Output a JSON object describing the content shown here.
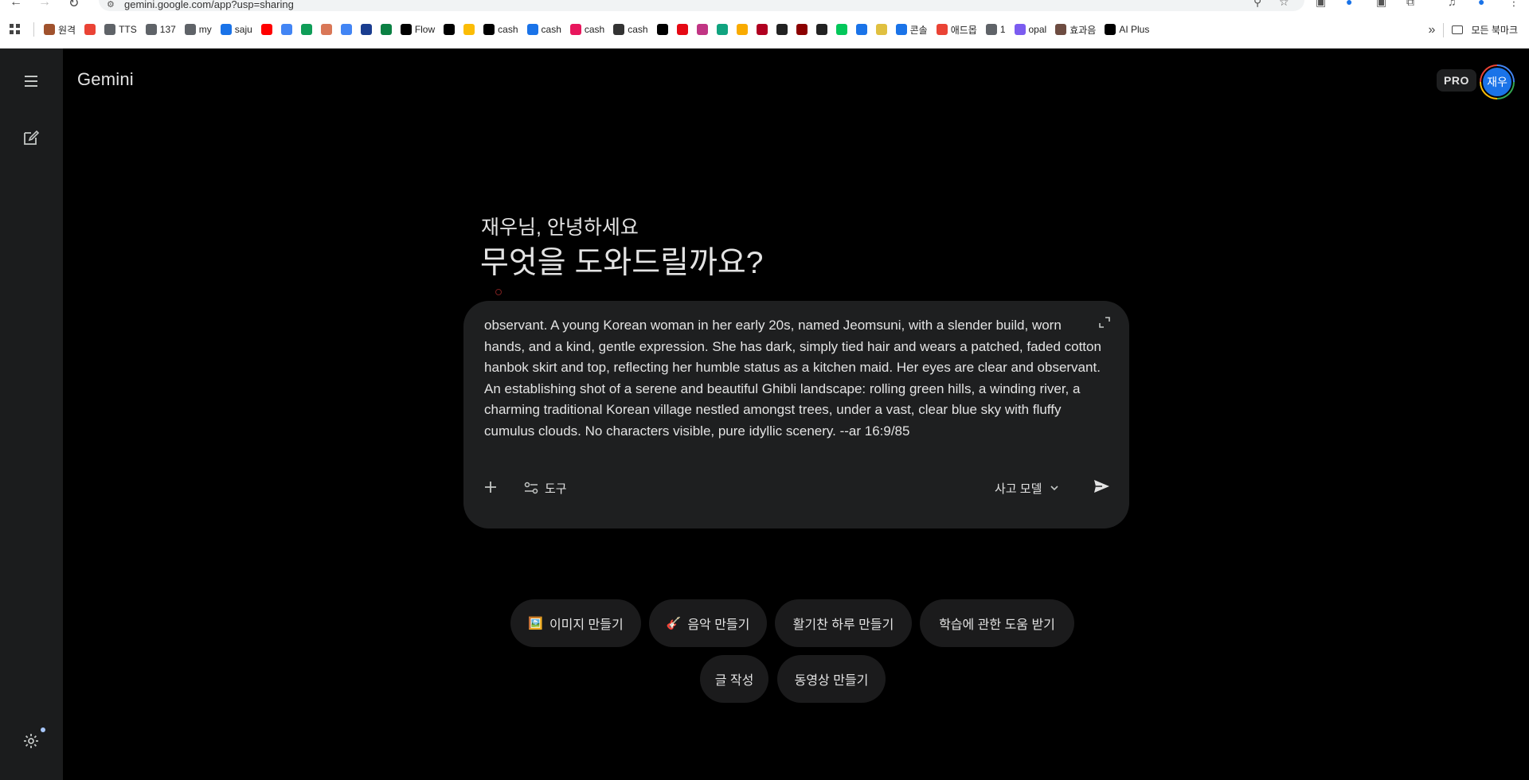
{
  "browser": {
    "url": "gemini.google.com/app?usp=sharing",
    "bookmarks": [
      {
        "label": "원격",
        "icon": "bookmark-folder-icon",
        "color": "#a0522d"
      },
      {
        "label": "",
        "icon": "gmail-icon",
        "color": "#ea4335"
      },
      {
        "label": "TTS",
        "icon": "globe-icon",
        "color": "#5f6368"
      },
      {
        "label": "137",
        "icon": "globe-icon",
        "color": "#5f6368"
      },
      {
        "label": "my",
        "icon": "globe-icon",
        "color": "#5f6368"
      },
      {
        "label": "saju",
        "icon": "saju-icon",
        "color": "#1a73e8"
      },
      {
        "label": "",
        "icon": "youtube-icon",
        "color": "#ff0000"
      },
      {
        "label": "",
        "icon": "docs-icon",
        "color": "#4285f4"
      },
      {
        "label": "",
        "icon": "sheets-icon",
        "color": "#0f9d58"
      },
      {
        "label": "",
        "icon": "claude-icon",
        "color": "#d97757"
      },
      {
        "label": "",
        "icon": "gemini-star-icon",
        "color": "#4285f4"
      },
      {
        "label": "",
        "icon": "p-icon",
        "color": "#1a3d8f"
      },
      {
        "label": "",
        "icon": "chart-icon",
        "color": "#0b8043"
      },
      {
        "label": "Flow",
        "icon": "flow-icon",
        "color": "#000000"
      },
      {
        "label": "",
        "icon": "openai-icon",
        "color": "#000000"
      },
      {
        "label": "",
        "icon": "drive-icon",
        "color": "#fbbc05"
      },
      {
        "label": "cash",
        "icon": "cash-icon",
        "color": "#000000"
      },
      {
        "label": "cash",
        "icon": "cash-icon",
        "color": "#1a73e8"
      },
      {
        "label": "cash",
        "icon": "cash-icon",
        "color": "#e8175d"
      },
      {
        "label": "cash",
        "icon": "cash-icon",
        "color": "#333333"
      },
      {
        "label": "",
        "icon": "triangle-icon",
        "color": "#000000"
      },
      {
        "label": "",
        "icon": "netflix-icon",
        "color": "#e50914"
      },
      {
        "label": "",
        "icon": "instagram-icon",
        "color": "#c13584"
      },
      {
        "label": "",
        "icon": "chatgpt-icon",
        "color": "#10a37f"
      },
      {
        "label": "",
        "icon": "cart-icon",
        "color": "#f9ab00"
      },
      {
        "label": "",
        "icon": "c-icon",
        "color": "#b00020"
      },
      {
        "label": "",
        "icon": "minus-circle-icon",
        "color": "#222222"
      },
      {
        "label": "",
        "icon": "shield-icon",
        "color": "#8b0000"
      },
      {
        "label": "",
        "icon": "minus-circle-icon",
        "color": "#222222"
      },
      {
        "label": "",
        "icon": "naver-icon",
        "color": "#03c75a"
      },
      {
        "label": "",
        "icon": "house-icon",
        "color": "#1a73e8"
      },
      {
        "label": "",
        "icon": "banner-icon",
        "color": "#e0c040"
      },
      {
        "label": "콘솔",
        "icon": "console-icon",
        "color": "#1a73e8"
      },
      {
        "label": "애드몹",
        "icon": "admob-icon",
        "color": "#ea4335"
      },
      {
        "label": "1",
        "icon": "globe-icon",
        "color": "#5f6368"
      },
      {
        "label": "opal",
        "icon": "opal-icon",
        "color": "#7b5cf0"
      },
      {
        "label": "효과음",
        "icon": "sound-icon",
        "color": "#6d4c41"
      },
      {
        "label": "AI Plus",
        "icon": "plus-square-icon",
        "color": "#000000"
      }
    ],
    "more_label": "»",
    "all_bookmarks_label": "모든 북마크"
  },
  "app": {
    "brand": "Gemini",
    "plan_badge": "PRO",
    "avatar_text": "재우",
    "greeting": "재우님, 안녕하세요",
    "headline": "무엇을 도와드릴까요?",
    "prompt_text": "observant. A young Korean woman in her early 20s, named Jeomsuni, with a slender build, worn hands, and a kind, gentle expression. She has dark, simply tied hair and wears a patched, faded cotton hanbok skirt and top, reflecting her humble status as a kitchen maid. Her eyes are clear and observant. An establishing shot of a serene and beautiful Ghibli landscape: rolling green hills, a winding river, a charming traditional Korean village nestled amongst trees, under a vast, clear blue sky with fluffy cumulus clouds. No characters visible, pure idyllic scenery. --ar 16:9/85",
    "tools_label": "도구",
    "model_label": "사고 모델",
    "chips": {
      "image": {
        "emoji": "🖼️",
        "label": "이미지 만들기"
      },
      "music": {
        "emoji": "🎸",
        "label": "음악 만들기"
      },
      "day": {
        "label": "활기찬 하루 만들기"
      },
      "study": {
        "label": "학습에 관한 도움 받기"
      },
      "write": {
        "label": "글 작성"
      },
      "video": {
        "label": "동영상 만들기"
      }
    }
  },
  "colors": {
    "background": "#000000",
    "sidebar": "#1b1c1d",
    "composer": "#1e1f20",
    "chip": "#1b1b1c",
    "text": "#e3e3e3",
    "avatar": "#1a73e8"
  }
}
